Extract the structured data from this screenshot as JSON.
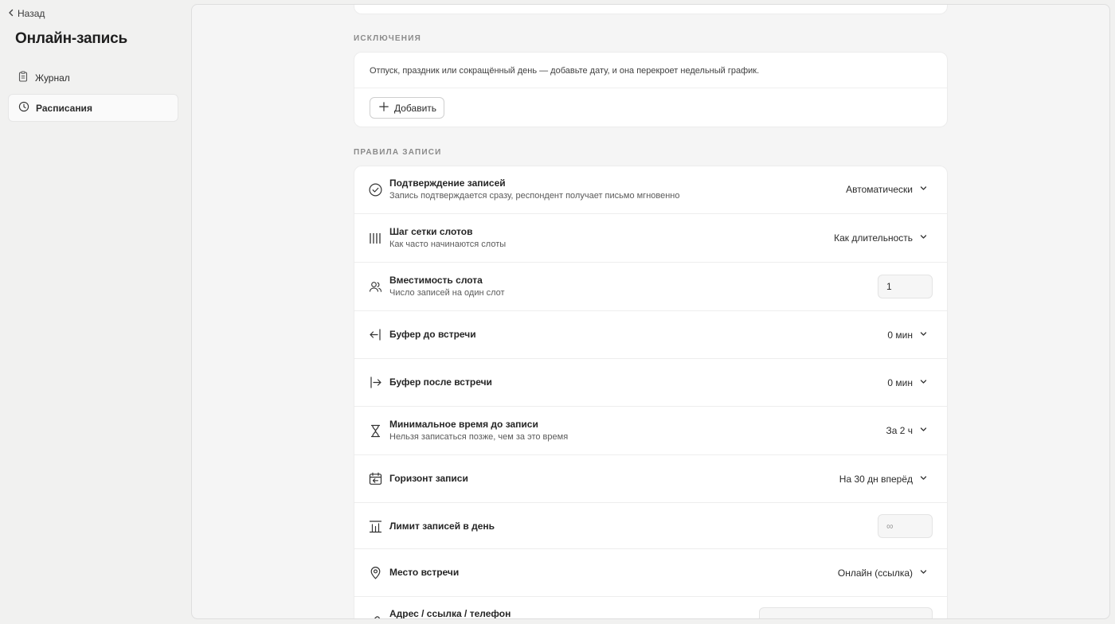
{
  "sidebar": {
    "back_label": "Назад",
    "title": "Онлайн-запись",
    "items": [
      {
        "label": "Журнал",
        "icon": "clipboard-icon",
        "active": false
      },
      {
        "label": "Расписания",
        "icon": "clock-icon",
        "active": true
      }
    ]
  },
  "exceptions": {
    "section_label": "ИСКЛЮЧЕНИЯ",
    "description": "Отпуск, праздник или сокращённый день — добавьте дату, и она перекроет недельный график.",
    "add_label": "Добавить"
  },
  "rules": {
    "section_label": "ПРАВИЛА ЗАПИСИ",
    "items": [
      {
        "title": "Подтверждение записей",
        "subtitle": "Запись подтверждается сразу, респондент получает письмо мгновенно",
        "value": "Автоматически",
        "control": "select",
        "icon": "check-circle-icon"
      },
      {
        "title": "Шаг сетки слотов",
        "subtitle": "Как часто начинаются слоты",
        "value": "Как длительность",
        "control": "select",
        "icon": "grid-bars-icon"
      },
      {
        "title": "Вместимость слота",
        "subtitle": "Число записей на один слот",
        "value": "1",
        "control": "input",
        "icon": "users-icon"
      },
      {
        "title": "Буфер до встречи",
        "subtitle": "",
        "value": "0 мин",
        "control": "select",
        "icon": "arrow-left-bar-icon"
      },
      {
        "title": "Буфер после встречи",
        "subtitle": "",
        "value": "0 мин",
        "control": "select",
        "icon": "arrow-right-bar-icon"
      },
      {
        "title": "Минимальное время до записи",
        "subtitle": "Нельзя записаться позже, чем за это время",
        "value": "За 2 ч",
        "control": "select",
        "icon": "hourglass-icon"
      },
      {
        "title": "Горизонт записи",
        "subtitle": "",
        "value": "На 30 дн вперёд",
        "control": "select",
        "icon": "calendar-arrow-icon"
      },
      {
        "title": "Лимит записей в день",
        "subtitle": "",
        "value": "",
        "placeholder": "∞",
        "control": "input",
        "icon": "chart-limit-icon"
      },
      {
        "title": "Место встречи",
        "subtitle": "",
        "value": "Онлайн (ссылка)",
        "control": "select",
        "icon": "map-pin-icon"
      },
      {
        "title": "Адрес / ссылка / телефон",
        "subtitle": "",
        "value": "",
        "control": "input-wide",
        "icon": "link-icon"
      }
    ]
  }
}
